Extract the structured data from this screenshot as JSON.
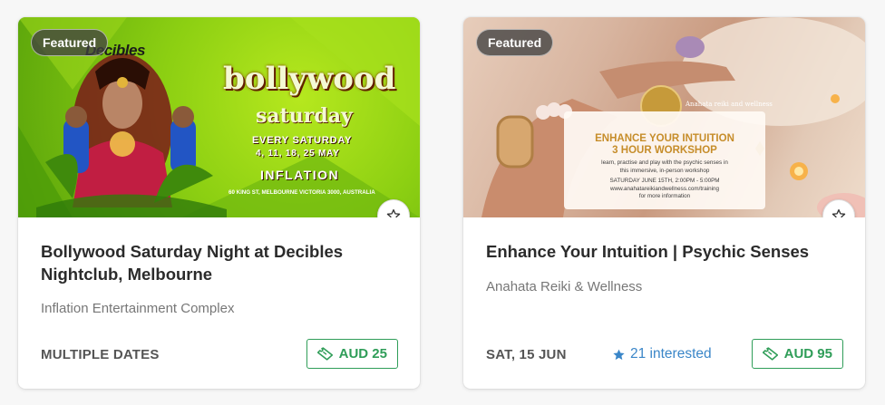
{
  "cards": [
    {
      "badge": "Featured",
      "title": "Bollywood Saturday Night at Decibles Nightclub, Melbourne",
      "venue": "Inflation Entertainment Complex",
      "date": "MULTIPLE DATES",
      "price": "AUD 25",
      "image": {
        "brand": "Decibles",
        "headline": "bollywood",
        "subhead": "saturday",
        "line1": "EVERY SATURDAY",
        "line2": "4, 11, 18, 25 MAY",
        "venue": "INFLATION",
        "address": "60 KING ST, MELBOURNE VICTORIA 3000, AUSTRALIA"
      }
    },
    {
      "badge": "Featured",
      "title": "Enhance Your Intuition | Psychic Senses",
      "venue": "Anahata Reiki & Wellness",
      "date": "SAT, 15 JUN",
      "interested": "21 interested",
      "price": "AUD 95",
      "image": {
        "brand": "Anahata reiki and wellness",
        "headline1": "ENHANCE YOUR INTUITION",
        "headline2": "3 HOUR WORKSHOP",
        "desc1": "learn, practise and play with the psychic senses in",
        "desc2": "this immersive, in-person workshop",
        "time": "SATURDAY JUNE 15TH, 2:00PM - 5:00PM",
        "url": "www.anahatareikiandwellness.com/training",
        "more": "for more information"
      }
    }
  ],
  "colors": {
    "price_green": "#2f9d58",
    "interested_blue": "#3a86c8",
    "gold": "#c68d2a"
  },
  "icons": {
    "favorite": "star-outline-icon",
    "price": "ticket-icon",
    "interested": "star-filled-icon"
  }
}
